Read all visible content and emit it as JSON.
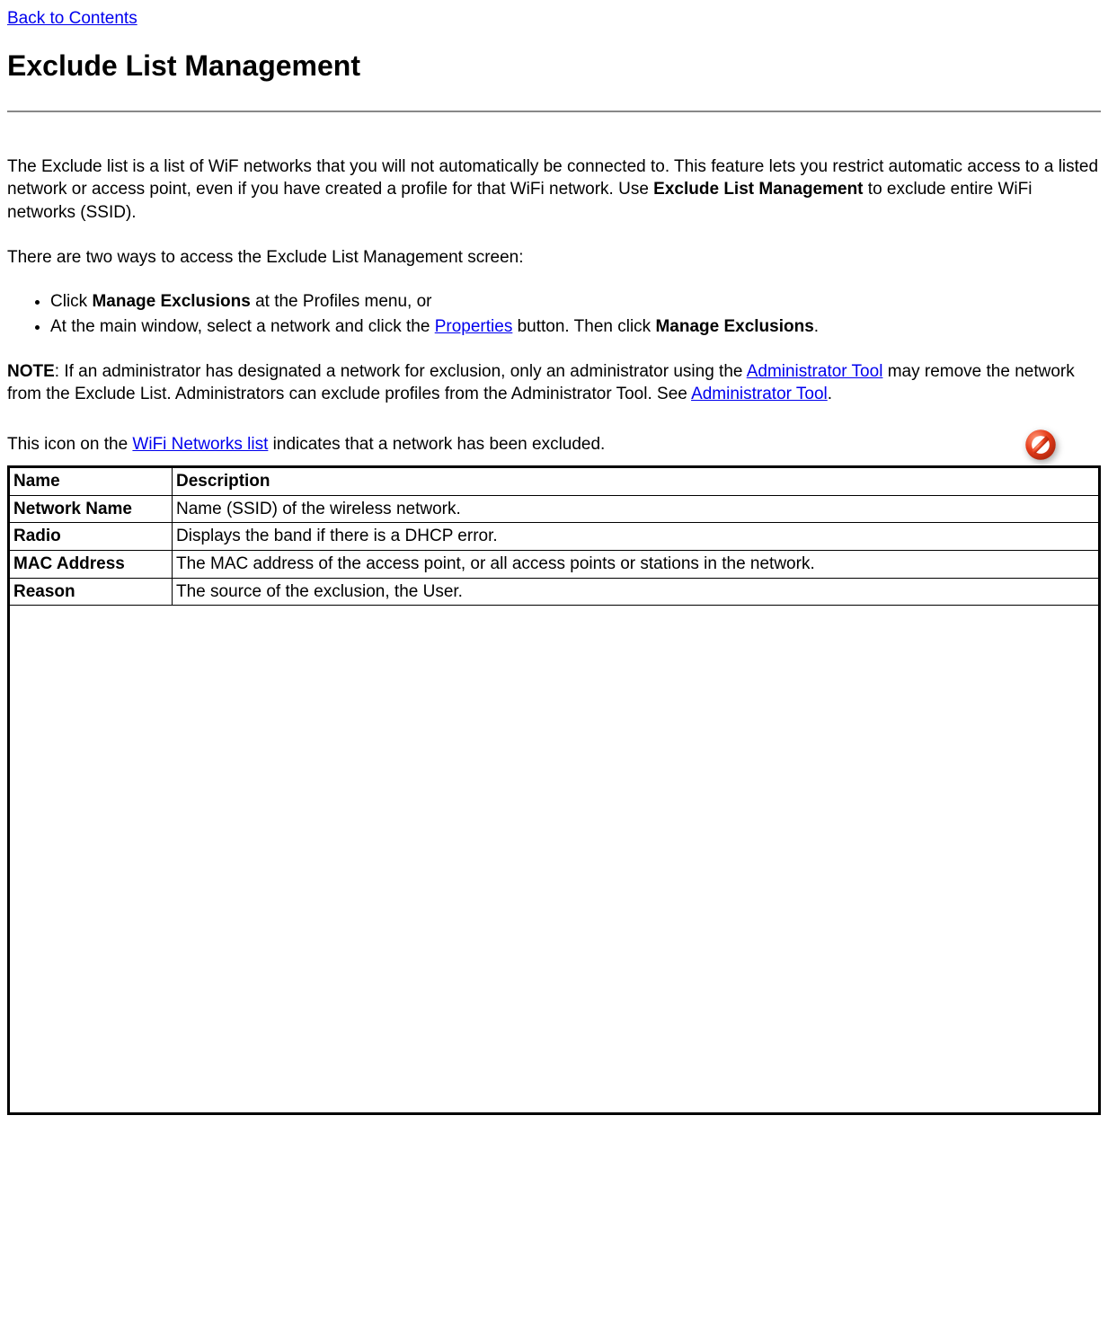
{
  "nav": {
    "back_link": "Back to Contents"
  },
  "heading": "Exclude List Management",
  "paragraphs": {
    "intro_part1": "The Exclude list is a list of WiF networks that you will not automatically be connected to. This feature lets you restrict automatic access to a listed network or access point, even if you have created a profile for that WiFi network. Use ",
    "intro_bold": "Exclude List Management",
    "intro_part2": " to exclude entire WiFi networks (SSID).",
    "access_intro": "There are two ways to access the Exclude List Management screen:",
    "bullet1_pre": "Click ",
    "bullet1_bold": "Manage Exclusions",
    "bullet1_post": " at the Profiles menu, or",
    "bullet2_pre": "At the main window, select a network and click the ",
    "bullet2_link": "Properties",
    "bullet2_mid": " button. Then click ",
    "bullet2_bold": "Manage Exclusions",
    "bullet2_post": ".",
    "note_label": "NOTE",
    "note_part1": ": If an administrator has designated a network for exclusion, only an administrator using the ",
    "note_link1": "Administrator Tool",
    "note_part2": " may remove the network from the Exclude List. Administrators can exclude profiles from the Administrator Tool. See ",
    "note_link2": "Administrator Tool",
    "note_part3": ".",
    "icon_pre": "This icon on the ",
    "icon_link": "WiFi Networks list",
    "icon_post": " indicates that a network has been excluded."
  },
  "table": {
    "headers": {
      "name": "Name",
      "description": "Description"
    },
    "rows": [
      {
        "name": "Network Name",
        "description": "Name (SSID) of the wireless network."
      },
      {
        "name": "Radio",
        "description": "Displays the band if there is a DHCP error."
      },
      {
        "name": "MAC Address",
        "description": "The MAC address of the access point, or all access points or stations in the network."
      },
      {
        "name": "Reason",
        "description": "The source of the exclusion, the User."
      }
    ]
  }
}
